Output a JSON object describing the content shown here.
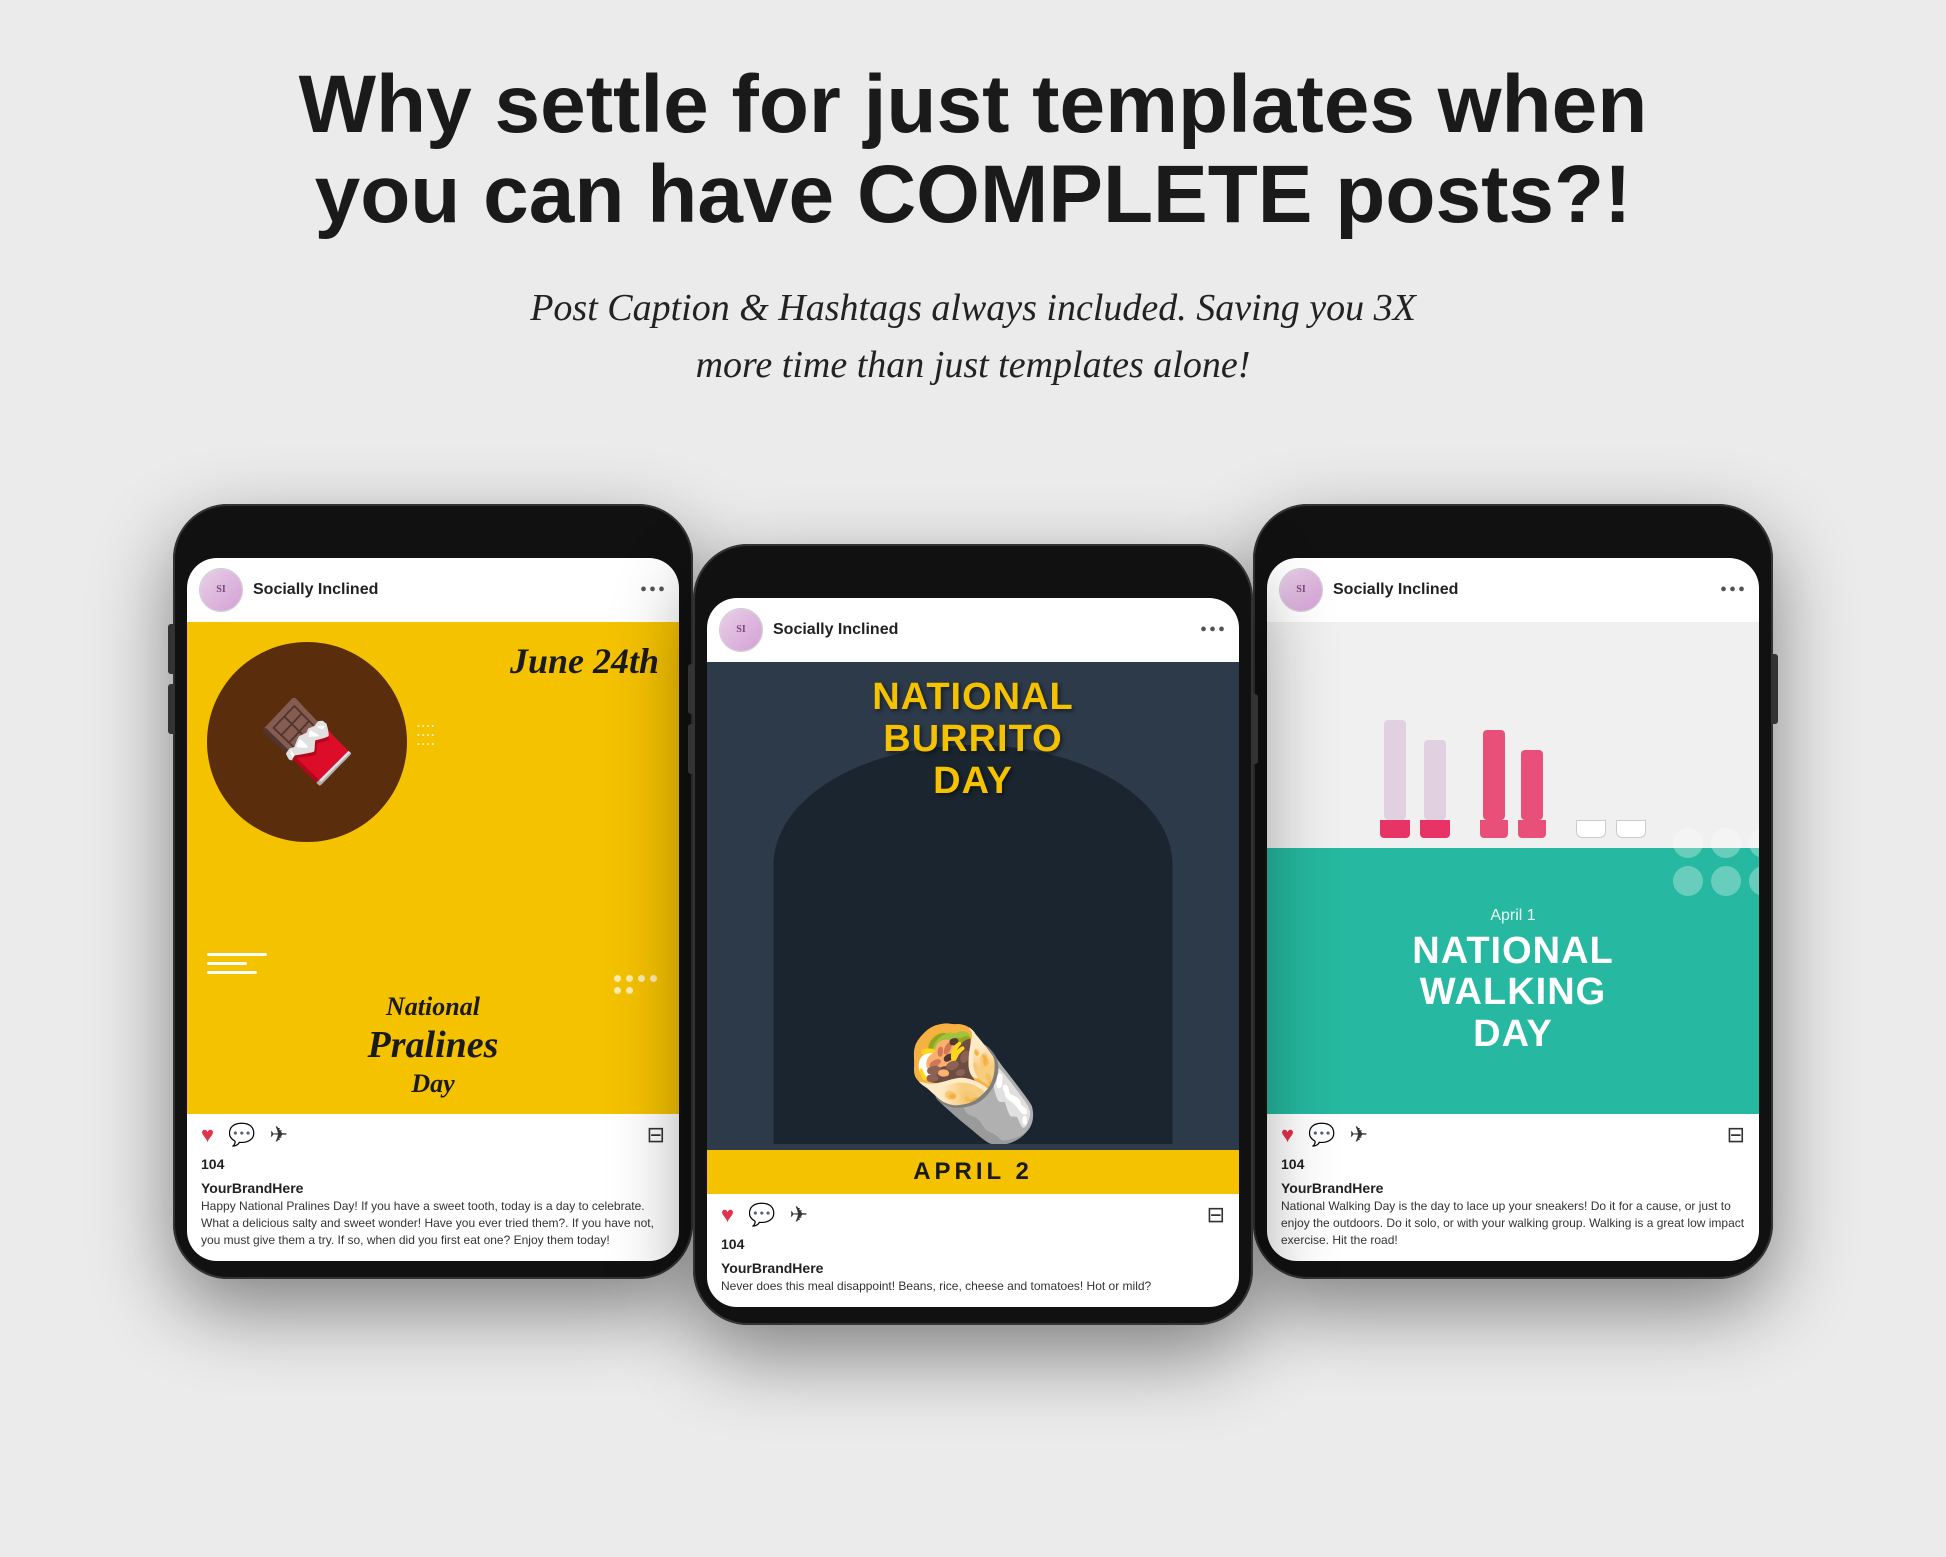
{
  "headline": {
    "line1": "Why settle for just templates when",
    "line2": "you can have COMPLETE posts?!"
  },
  "subheadline": {
    "text": "Post Caption & Hashtags always included. Saving you 3X more time than just templates alone!"
  },
  "phones": [
    {
      "id": "left",
      "username": "Socially Inclined",
      "post_type": "pralines",
      "date_label": "June 24th",
      "post_title": "National Pralines Day",
      "likes": "104",
      "brand": "YourBrandHere",
      "caption": "Happy National Pralines Day! If you have a sweet tooth, today is a day to celebrate. What a delicious salty and sweet wonder! Have you ever tried them?. If you have not, you must give them a try. If so, when did you first eat one? Enjoy them today!"
    },
    {
      "id": "middle",
      "username": "Socially Inclined",
      "post_type": "burrito",
      "date_label": "APRIL 2",
      "post_title": "NATIONAL BURRITO DAY",
      "likes": "104",
      "brand": "YourBrandHere",
      "caption": "Never does this meal disappoint! Beans, rice, cheese and tomatoes! Hot or mild?"
    },
    {
      "id": "right",
      "username": "Socially Inclined",
      "post_type": "walking",
      "date_label": "April 1",
      "post_title": "NATIONAL WALKING DAY",
      "likes": "104",
      "brand": "YourBrandHere",
      "caption": "National Walking Day is the day to lace up your sneakers! Do it for a cause, or just to enjoy the outdoors. Do it solo, or with your walking group. Walking is a great low impact exercise. Hit the road!"
    }
  ],
  "icons": {
    "heart": "♥",
    "comment": "○",
    "share": "➤",
    "bookmark": "🔖",
    "dots": "•••"
  },
  "colors": {
    "pralines_yellow": "#f5c200",
    "burrito_dark": "#2d3a4a",
    "walking_teal": "#26b8a0",
    "background": "#ebebeb"
  }
}
